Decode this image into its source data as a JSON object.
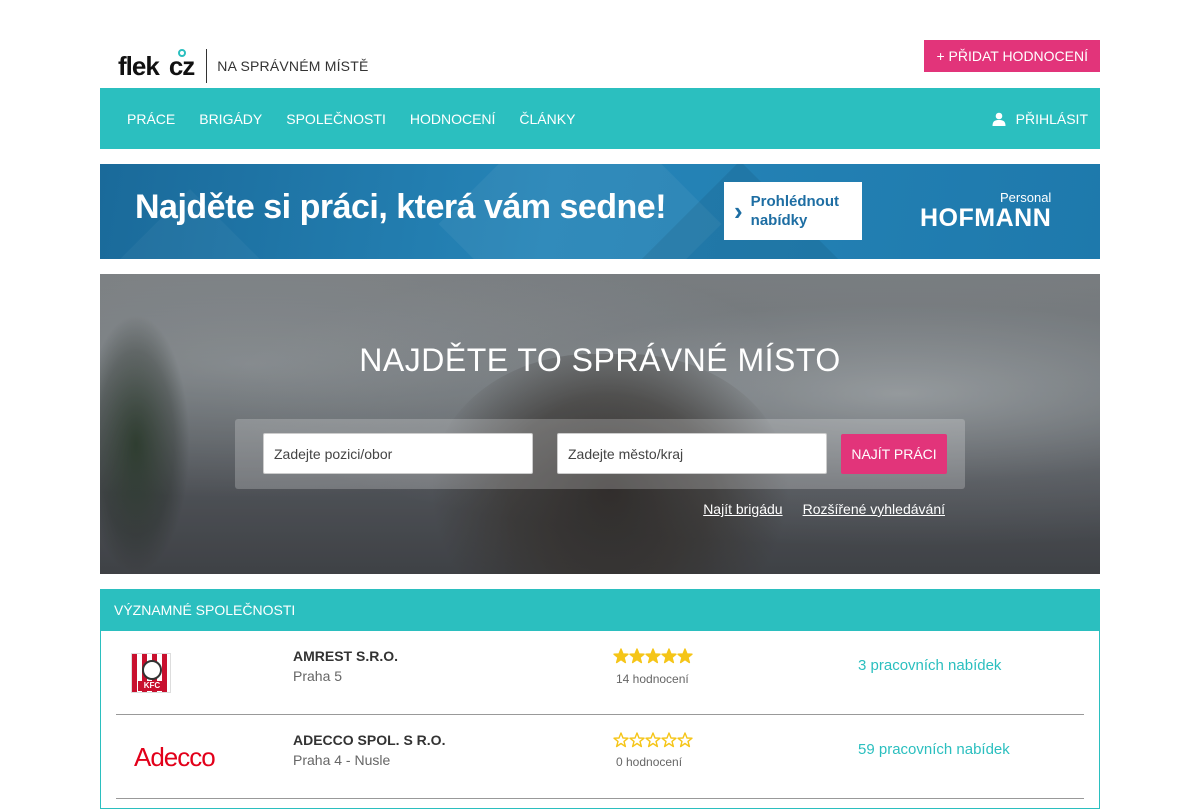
{
  "header": {
    "logo_text": "flek cz",
    "slogan": "NA SPRÁVNÉM MÍSTĚ",
    "add_review_label": "+ PŘIDAT HODNOCENÍ"
  },
  "nav": {
    "items": [
      {
        "label": "PRÁCE"
      },
      {
        "label": "BRIGÁDY"
      },
      {
        "label": "SPOLEČNOSTI"
      },
      {
        "label": "HODNOCENÍ"
      },
      {
        "label": "ČLÁNKY"
      }
    ],
    "login_label": "PŘIHLÁSIT"
  },
  "banner": {
    "headline": "Najděte si práci, která vám sedne!",
    "cta_label": "Prohlédnout nabídky",
    "brand_sub": "Personal",
    "brand": "HOFMANN"
  },
  "hero": {
    "title": "NAJDĚTE TO SPRÁVNÉ MÍSTO",
    "position_placeholder": "Zadejte pozici/obor",
    "location_placeholder": "Zadejte město/kraj",
    "search_button": "NAJÍT PRÁCI",
    "link_brigade": "Najít brigádu",
    "link_advanced": "Rozšířené vyhledávání"
  },
  "companies": {
    "title": "VÝZNAMNÉ SPOLEČNOSTI",
    "rows": [
      {
        "logo": "KFC",
        "name": "AMREST S.R.O.",
        "city": "Praha 5",
        "rating": 5,
        "reviews": "14 hodnocení",
        "offers": "3 pracovních nabídek",
        "star_color": "#f5c518"
      },
      {
        "logo": "Adecco",
        "name": "ADECCO SPOL. S R.O.",
        "city": "Praha 4 - Nusle",
        "rating": 0,
        "reviews": "0 hodnocení",
        "offers": "59 pracovních nabídek",
        "star_color": "#f5c518"
      }
    ]
  },
  "colors": {
    "accent": "#2bbfbf",
    "brand_pink": "#e2347a"
  }
}
